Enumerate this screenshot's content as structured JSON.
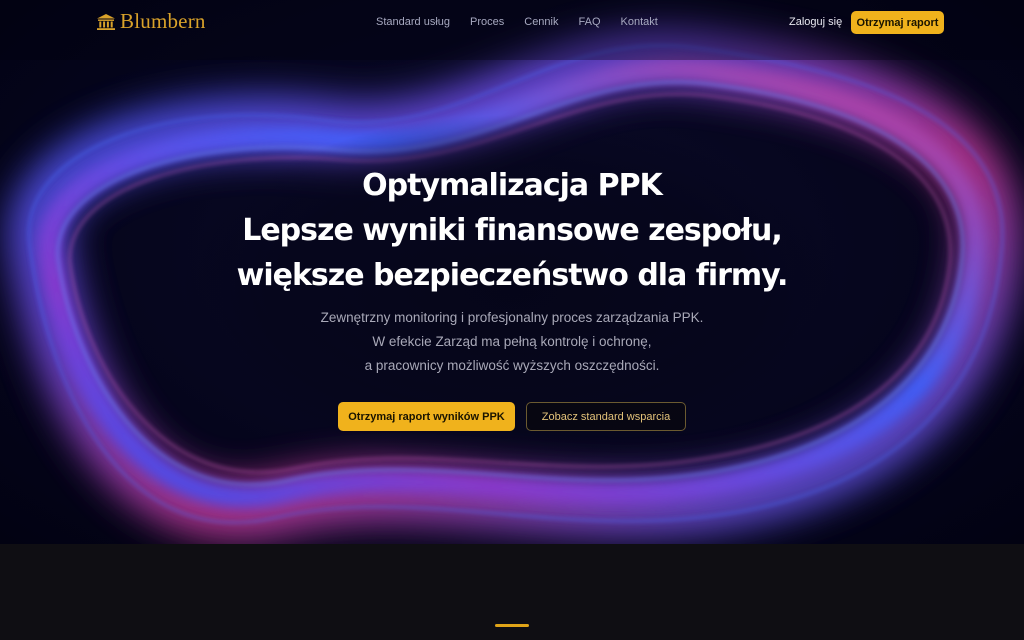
{
  "brand": {
    "name": "Blumbern",
    "logo_icon": "bank-building-icon",
    "accent": "#f0b21c"
  },
  "nav": {
    "links": [
      "Standard usług",
      "Proces",
      "Cennik",
      "FAQ",
      "Kontakt"
    ],
    "login_label": "Zaloguj się",
    "cta_label": "Otrzymaj raport"
  },
  "hero": {
    "headline": [
      "Optymalizacja PPK",
      "Lepsze wyniki finansowe zespołu,",
      "większe bezpieczeństwo dla firmy."
    ],
    "subtitle": [
      "Zewnętrzny monitoring i profesjonalny proces zarządzania PPK.",
      "W efekcie Zarząd ma pełną kontrolę i ochronę,",
      "a pracownicy możliwość wyższych oszczędności."
    ],
    "primary_button": "Otrzymaj raport wyników PPK",
    "secondary_button": "Zobacz standard wsparcia"
  },
  "colors": {
    "background": "#0f0e13",
    "hero_bg": "#04041a",
    "glow_blue": "#2f4bff",
    "glow_pink": "#c03ca0"
  }
}
